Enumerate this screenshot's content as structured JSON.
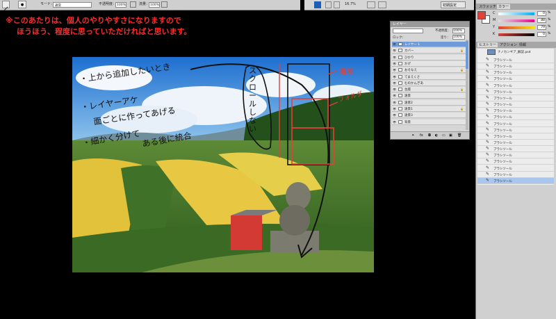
{
  "options_bar": {
    "mode_label": "モード：",
    "mode_value": "通常",
    "opacity_label": "不透明度：",
    "opacity_value": "100%",
    "flow_label": "流量：",
    "flow_value": "100%"
  },
  "app_bar": {
    "zoom": "16.7%",
    "workspace": "初期設定"
  },
  "annotation": {
    "line1": "※このあたりは、個人のやりやすさになりますので",
    "line2": "ほうほう、程度に思っていただければと思います。",
    "color": "#ff2b2b"
  },
  "drawing_notes": {
    "note1": "・上から追加したいとき",
    "note2": "・レイヤーアケ",
    "note3": "面ごとに作ってあげる",
    "note4": "・細かく分けて",
    "note5": "ある後に統合",
    "bubble": "スクロールしない",
    "label_add": "追加",
    "label_folder": "フォルダ"
  },
  "layers_panel": {
    "title": "レイヤー",
    "opacity_label": "不透明度：",
    "opacity_value": "100%",
    "lock_label": "ロック：",
    "fill_label": "塗り：",
    "fill_value": "100%",
    "layers": [
      {
        "name": "レイヤー 1",
        "selected": true
      },
      {
        "name": "カバー",
        "selected": false
      },
      {
        "name": "ひかり",
        "selected": false
      },
      {
        "name": "かげ",
        "selected": false
      },
      {
        "name": "おそなえ",
        "selected": false
      },
      {
        "name": "てまえくさ",
        "selected": false
      },
      {
        "name": "むのかんぎあ",
        "selected": false
      },
      {
        "name": "台座",
        "selected": false
      },
      {
        "name": "遠景",
        "selected": false
      },
      {
        "name": "遠景2",
        "selected": false
      },
      {
        "name": "遠景1",
        "selected": false
      },
      {
        "name": "遠景3",
        "selected": false
      },
      {
        "name": "背景",
        "selected": false
      }
    ]
  },
  "color_panel": {
    "tab_swatches": "スウォッチ",
    "tab_color": "カラー",
    "foreground_color": "#e0413a",
    "background_color": "#ffffff",
    "channels": [
      {
        "label": "C",
        "value": "0"
      },
      {
        "label": "M",
        "value": "88"
      },
      {
        "label": "Y",
        "value": "79"
      },
      {
        "label": "K",
        "value": "0"
      }
    ]
  },
  "history_panel": {
    "tab_history": "ヒストリー",
    "tab_actions": "アクション",
    "tab_info": "情報",
    "snapshot": "ナノカンギア_解説.psd",
    "steps": [
      "ブラシツール",
      "ブラシツール",
      "ブラシツール",
      "ブラシツール",
      "ブラシツール",
      "ブラシツール",
      "ブラシツール",
      "ブラシツール",
      "ブラシツール",
      "ブラシツール",
      "ブラシツール",
      "ブラシツール",
      "ブラシツール",
      "ブラシツール",
      "ブラシツール",
      "ブラシツール",
      "ブラシツール",
      "ブラシツール",
      "ブラシツール",
      "ブラシツール"
    ]
  }
}
